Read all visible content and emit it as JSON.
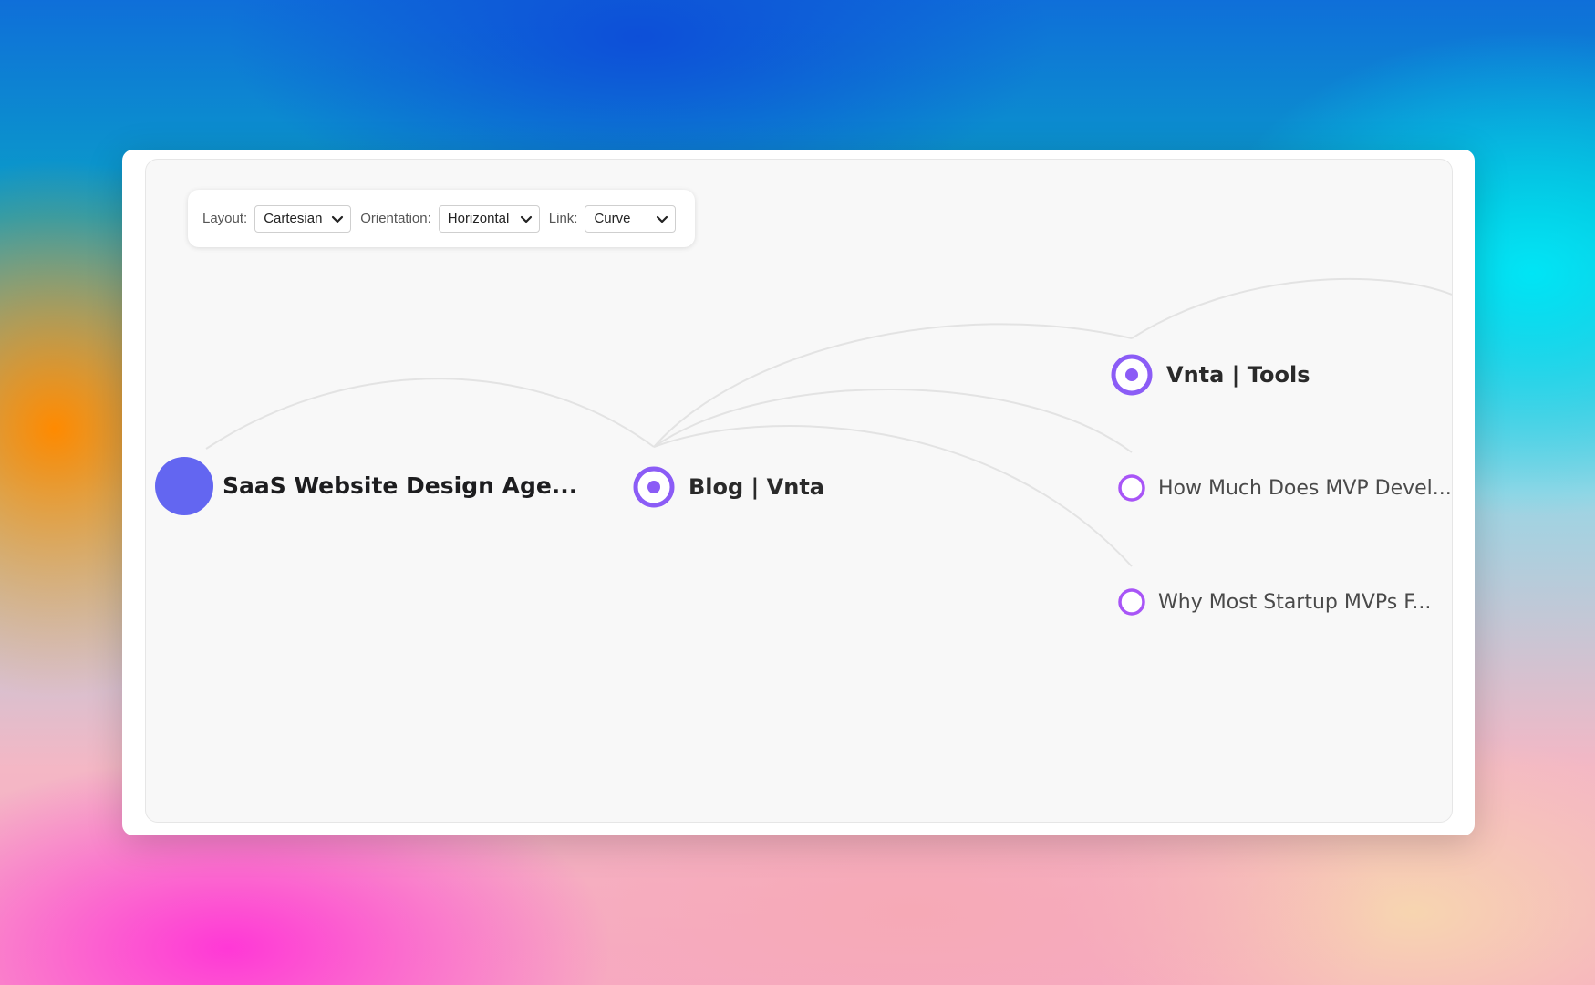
{
  "toolbar": {
    "layout_label": "Layout:",
    "layout_value": "Cartesian",
    "orientation_label": "Orientation:",
    "orientation_value": "Horizontal",
    "link_label": "Link:",
    "link_value": "Curve"
  },
  "tree": {
    "root": {
      "label": "SaaS Website Design Age...",
      "color": "#6366f1"
    },
    "level1": [
      {
        "label": "Blog | Vnta",
        "color": "#8b5cf6"
      }
    ],
    "level2": [
      {
        "label": "Vnta | Tools",
        "color": "#8b5cf6"
      },
      {
        "label": "How Much Does MVP Devel...",
        "color": "#a855f7"
      },
      {
        "label": "Why Most Startup MVPs F...",
        "color": "#a855f7"
      }
    ]
  },
  "colors": {
    "link": "#e3e3e3",
    "canvas": "#f8f8f8"
  }
}
